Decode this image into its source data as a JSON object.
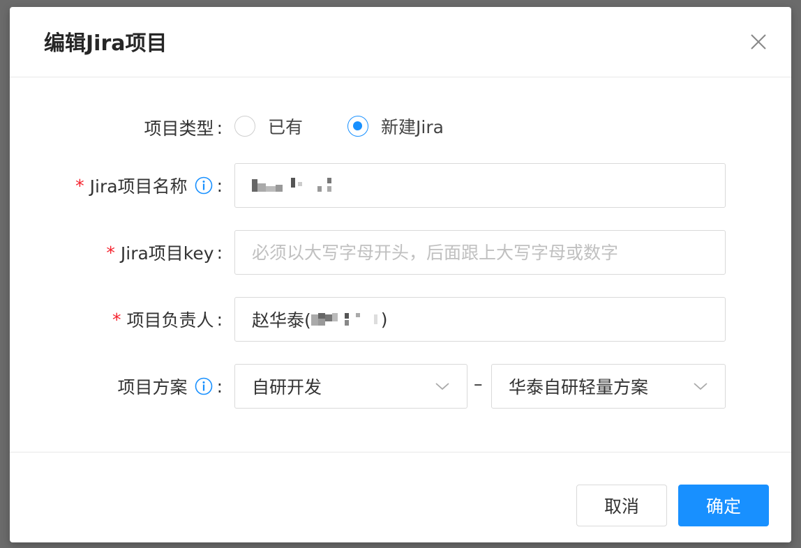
{
  "dialog": {
    "title": "编辑Jira项目"
  },
  "form": {
    "project_type": {
      "label": "项目类型",
      "colon": ":",
      "options": [
        "已有",
        "新建Jira"
      ],
      "selected": "新建Jira"
    },
    "project_name": {
      "required_mark": "*",
      "label": "Jira项目名称",
      "colon": ":",
      "value": ""
    },
    "project_key": {
      "required_mark": "*",
      "label": "Jira项目key",
      "colon": ":",
      "placeholder": "必须以大写字母开头，后面跟上大写字母或数字"
    },
    "project_owner": {
      "required_mark": "*",
      "label": "项目负责人",
      "colon": ":",
      "value_prefix": "赵华泰(",
      "value_suffix": ")"
    },
    "project_plan": {
      "label": "项目方案",
      "colon": ":",
      "select_1": "自研开发",
      "separator": "–",
      "select_2": "华泰自研轻量方案"
    }
  },
  "footer": {
    "cancel_label": "取消",
    "ok_label": "确定"
  },
  "colors": {
    "primary": "#1890ff",
    "required": "#f5222d",
    "border": "#d9d9d9",
    "placeholder": "#c0c0c0"
  },
  "icons": [
    "close-icon",
    "info-icon",
    "chevron-down-icon"
  ]
}
